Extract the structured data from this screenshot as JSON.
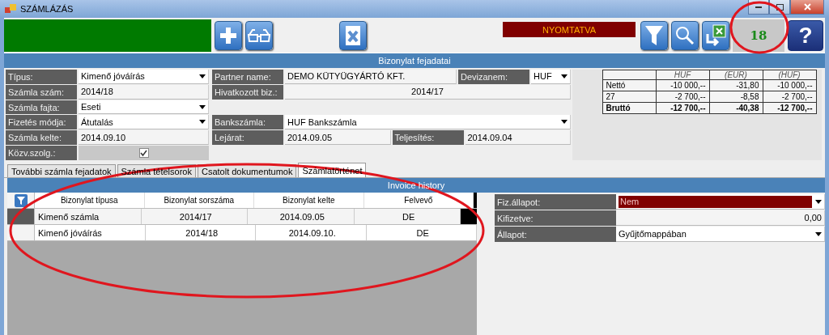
{
  "window": {
    "title": "SZÁMLÁZÁS"
  },
  "toolbar": {
    "status": "NYOMTATVA",
    "counter": "18",
    "help": "?",
    "left_buttons": [
      {
        "kind": "add"
      },
      {
        "kind": "view"
      }
    ],
    "middle_buttons": [
      {
        "kind": "delete"
      }
    ],
    "right_buttons": [
      {
        "kind": "filter"
      },
      {
        "kind": "search"
      },
      {
        "kind": "export"
      }
    ]
  },
  "header": {
    "title": "Bizonylat fejadatai"
  },
  "form": {
    "rows": [
      {
        "fields": [
          {
            "label": "Típus:",
            "value": "Kimenő jóváírás",
            "kind": "dropdown"
          },
          {
            "label": "Partner name:",
            "value": "DEMO KÜTYÜGYÁRTÓ KFT.",
            "kind": "text"
          },
          {
            "label": "Devizanem:",
            "value": "HUF",
            "kind": "dropdown"
          }
        ]
      },
      {
        "fields": [
          {
            "label": "Számla szám:",
            "value": "2014/18",
            "kind": "text"
          },
          {
            "label": "Hivatkozott biz.:",
            "value": "2014/17",
            "kind": "centered"
          }
        ]
      },
      {
        "fields": [
          {
            "label": "Számla fajta:",
            "value": "Eseti",
            "kind": "dropdown"
          }
        ]
      },
      {
        "fields": [
          {
            "label": "Fizetés módja:",
            "value": "Átutalás",
            "kind": "dropdown"
          },
          {
            "label": "Bankszámla:",
            "value": "HUF Bankszámla",
            "kind": "dropdown"
          }
        ]
      },
      {
        "fields": [
          {
            "label": "Számla kelte:",
            "value": "2014.09.10",
            "kind": "text"
          },
          {
            "label": "Lejárat:",
            "value": "2014.09.05",
            "kind": "text"
          },
          {
            "label": "Teljesítés:",
            "value": "2014.09.04",
            "kind": "text"
          }
        ]
      },
      {
        "fields": [
          {
            "label": "Közv.szolg.:",
            "kind": "checkbox",
            "checked": true
          }
        ]
      }
    ]
  },
  "totals": {
    "columns": [
      "HUF",
      "(EUR)",
      "(HUF)"
    ],
    "rows": [
      {
        "label": "Nettó",
        "kind": "line",
        "values": [
          "-10 000,--",
          "-31,80",
          "-10 000,--"
        ]
      },
      {
        "label": "27",
        "kind": "line",
        "values": [
          "-2 700,--",
          "-8,58",
          "-2 700,--"
        ]
      },
      {
        "label": "Bruttó",
        "kind": "total",
        "values": [
          "-12 700,--",
          "-40,38",
          "-12 700,--"
        ]
      }
    ]
  },
  "tabs": [
    {
      "label": "További számla fejadatok",
      "selected": false
    },
    {
      "label": "Számla tételsorok",
      "selected": false
    },
    {
      "label": "Csatolt dokumentumok",
      "selected": false
    },
    {
      "label": "Számlatörténet",
      "selected": true
    }
  ],
  "history": {
    "title": "Invoice history",
    "columns": [
      "Bizonylat típusa",
      "Bizonylat sorszáma",
      "Bizonylat kelte",
      "Felvevő"
    ],
    "rows": [
      {
        "selected": true,
        "cells": [
          "Kimenő számla",
          "2014/17",
          "2014.09.05",
          "DE"
        ]
      },
      {
        "selected": false,
        "cells": [
          "Kimenő jóváírás",
          "2014/18",
          "2014.09.10.",
          "DE"
        ]
      }
    ]
  },
  "payment": {
    "fields": [
      {
        "label": "Fiz.állapot:",
        "value": "Nem",
        "kind": "dropdown",
        "alert": true
      },
      {
        "label": "Kifizetve:",
        "value": "0,00",
        "kind": "number",
        "alert": false
      },
      {
        "label": "Állapot:",
        "value": "Gyűjtőmappában",
        "kind": "dropdown",
        "alert": false
      }
    ]
  }
}
